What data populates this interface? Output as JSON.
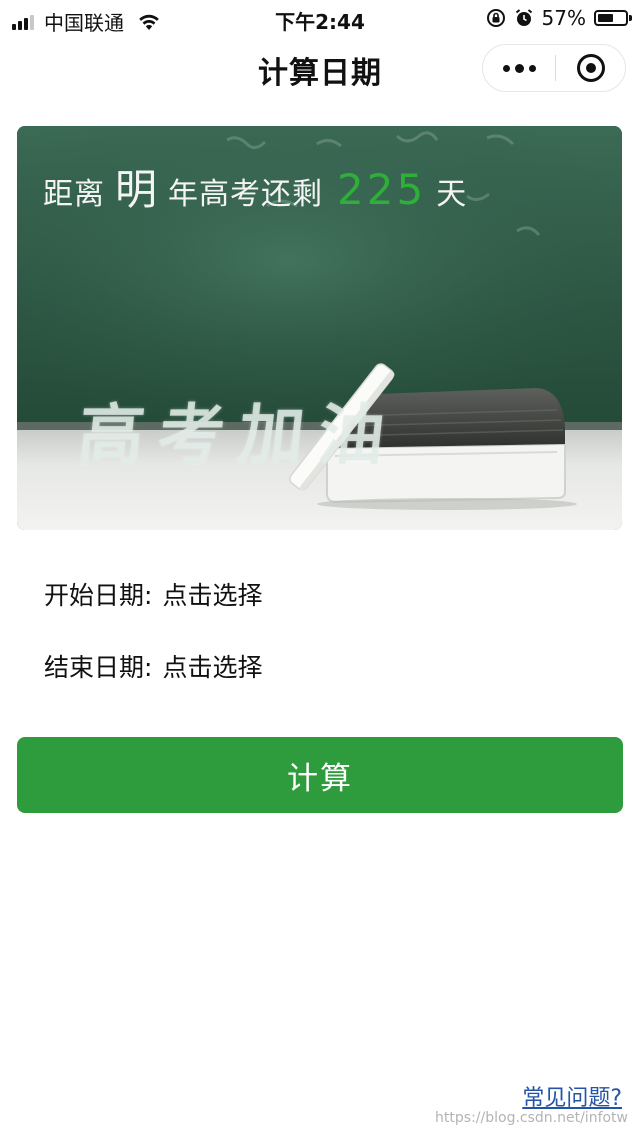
{
  "status_bar": {
    "carrier": "中国联通",
    "time": "下午2:44",
    "battery": "57%",
    "battery_level": 0.57
  },
  "nav": {
    "title": "计算日期"
  },
  "banner": {
    "prefix": "距离",
    "year": "明",
    "middle": "年高考还剩",
    "days": "225",
    "suffix": "天",
    "chalk_text": "高考加油"
  },
  "form": {
    "start_label": "开始日期:",
    "start_value": "点击选择",
    "end_label": "结束日期:",
    "end_value": "点击选择",
    "submit_label": "计算"
  },
  "footer": {
    "faq": "常见问题?",
    "watermark": "https://blog.csdn.net/infotw"
  },
  "colors": {
    "accent_green": "#2e9b3c",
    "days_green": "#2fae3a",
    "link_blue": "#2554a6"
  }
}
